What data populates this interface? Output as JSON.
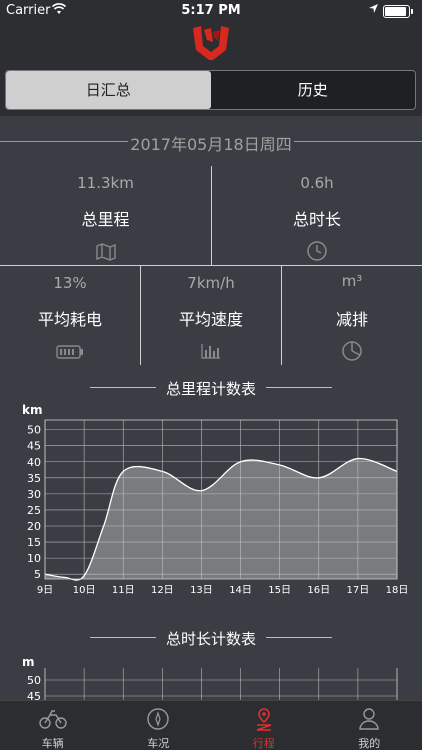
{
  "status": {
    "carrier": "Carrier",
    "time": "5:17 PM",
    "battery_level": 0.9
  },
  "colors": {
    "accent": "#e0302a",
    "background": "#3a3d43",
    "header": "#2c2e32"
  },
  "segmented": {
    "tabs": [
      {
        "label": "日汇总",
        "active": true
      },
      {
        "label": "历史",
        "active": false
      }
    ]
  },
  "date": "2017年05月18日周四",
  "stats_top": [
    {
      "value": "11.3km",
      "label": "总里程",
      "icon": "map-icon"
    },
    {
      "value": "0.6h",
      "label": "总时长",
      "icon": "clock-icon"
    }
  ],
  "stats_bottom": [
    {
      "value": "13%",
      "label": "平均耗电",
      "icon": "battery-icon"
    },
    {
      "value": "7km/h",
      "label": "平均速度",
      "icon": "bar-chart-icon"
    },
    {
      "value": "m³",
      "label": "减排",
      "icon": "pie-chart-icon"
    }
  ],
  "chart_data": [
    {
      "type": "area",
      "title": "总里程计数表",
      "ylabel": "km",
      "categories": [
        "9日",
        "10日",
        "11日",
        "12日",
        "13日",
        "14日",
        "15日",
        "16日",
        "17日",
        "18日"
      ],
      "x": [
        9,
        9.5,
        10,
        10.5,
        11,
        12,
        13,
        14,
        15,
        16,
        17,
        18
      ],
      "y": [
        5,
        4,
        4.5,
        20,
        37,
        37,
        31,
        40,
        39,
        35,
        41,
        37
      ],
      "yticks": [
        5,
        10,
        15,
        20,
        25,
        30,
        35,
        40,
        45,
        50
      ],
      "ylim": [
        3.5,
        53
      ],
      "xlim": [
        9,
        18
      ],
      "grid": true
    },
    {
      "type": "area",
      "title": "总时长计数表",
      "ylabel": "m",
      "yticks": [
        45,
        50
      ],
      "grid": true
    }
  ],
  "tabbar": [
    {
      "label": "车辆",
      "icon": "motorcycle-icon",
      "active": false
    },
    {
      "label": "车况",
      "icon": "compass-icon",
      "active": false
    },
    {
      "label": "行程",
      "icon": "route-icon",
      "active": true
    },
    {
      "label": "我的",
      "icon": "person-icon",
      "active": false
    }
  ]
}
